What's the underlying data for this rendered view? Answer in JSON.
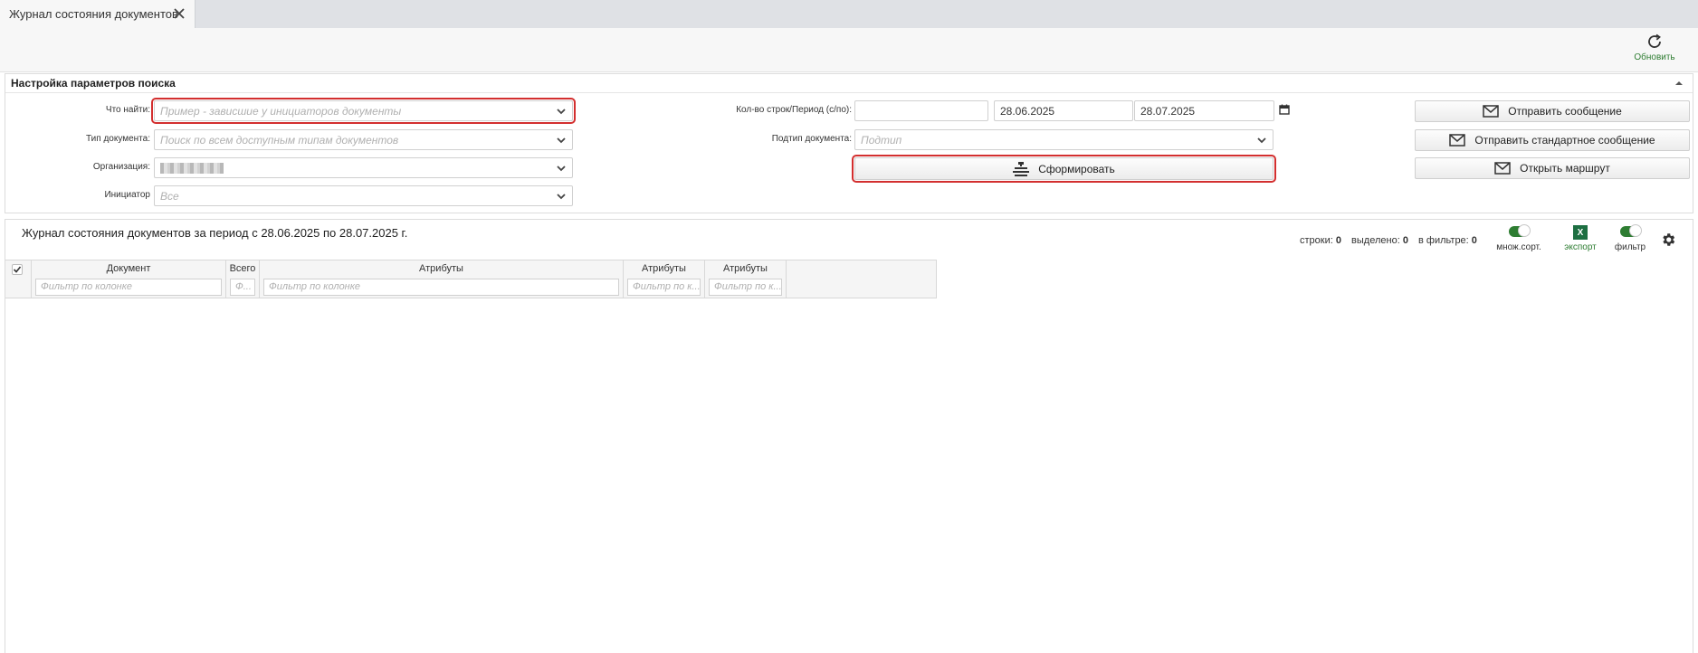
{
  "tab": {
    "title": "Журнал состояния документов"
  },
  "toolbar": {
    "refresh_label": "Обновить"
  },
  "search_panel": {
    "title": "Настройка параметров поиска",
    "what_to_find": {
      "label": "Что найти:",
      "placeholder": "Пример - зависшие у инициаторов документы"
    },
    "doc_type": {
      "label": "Тип документа:",
      "placeholder": "Поиск по всем доступным типам документов"
    },
    "organization": {
      "label": "Организация:"
    },
    "initiator": {
      "label": "Инициатор",
      "placeholder": "Все"
    },
    "rows_period": {
      "label": "Кол-во строк/Период (с/по):",
      "rows_value": "",
      "date_from": "28.06.2025",
      "date_to": "28.07.2025"
    },
    "subtype": {
      "label": "Подтип документа:",
      "placeholder": "Подтип"
    },
    "generate_label": "Сформировать",
    "actions": {
      "send_message": "Отправить сообщение",
      "send_standard": "Отправить стандартное сообщение",
      "open_route": "Открыть маршрут"
    }
  },
  "journal": {
    "title": "Журнал состояния документов за период с 28.06.2025 по 28.07.2025 г.",
    "stats": {
      "rows_label": "строки:",
      "rows": "0",
      "selected_label": "выделено:",
      "selected": "0",
      "filtered_label": "в фильтре:",
      "filtered": "0"
    },
    "multisort_label": "множ.сорт.",
    "export_label": "экспорт",
    "export_icon_text": "X",
    "filter_label": "фильтр",
    "columns": [
      {
        "header": "Документ",
        "filter": "Фильтр по колонке"
      },
      {
        "header": "Всего",
        "filter": "Ф..."
      },
      {
        "header": "Атрибуты",
        "filter": "Фильтр по колонке"
      },
      {
        "header": "Атрибуты",
        "filter": "Фильтр по к..."
      },
      {
        "header": "Атрибуты",
        "filter": "Фильтр по к..."
      }
    ]
  },
  "colors": {
    "accent_green": "#2e7d32",
    "highlight_red": "#d32f2f"
  }
}
